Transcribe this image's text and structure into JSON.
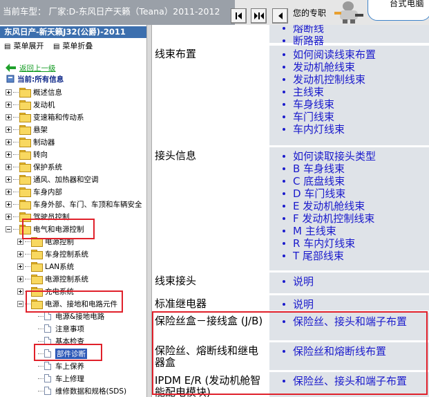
{
  "header": {
    "vehicle_text": "当前车型：  厂家:D-东风日产天籁（Teana）2011-2012",
    "help_text": "您的专职",
    "ad_text": "台式电脑"
  },
  "toolbar": {
    "buttons": [
      {
        "name": "nav-first-button",
        "icon": "first-page-icon"
      },
      {
        "name": "nav-split-button",
        "icon": "expand-icon"
      },
      {
        "name": "nav-back-button",
        "icon": "back-icon"
      }
    ]
  },
  "sidebar": {
    "model_title": "东风日产-新天籁J32(公爵)-2011",
    "expand_menu": "菜单展开",
    "collapse_menu": "菜单折叠",
    "back_link": "返回上一级",
    "current_info": "当前:所有信息",
    "tree": [
      {
        "label": "概述信息",
        "level": 0,
        "type": "folder",
        "expanded": false
      },
      {
        "label": "发动机",
        "level": 0,
        "type": "folder",
        "expanded": false
      },
      {
        "label": "变速箱和传动系",
        "level": 0,
        "type": "folder",
        "expanded": false
      },
      {
        "label": "悬架",
        "level": 0,
        "type": "folder",
        "expanded": false
      },
      {
        "label": "制动器",
        "level": 0,
        "type": "folder",
        "expanded": false
      },
      {
        "label": "转向",
        "level": 0,
        "type": "folder",
        "expanded": false
      },
      {
        "label": "保护系统",
        "level": 0,
        "type": "folder",
        "expanded": false
      },
      {
        "label": "通风、加热器和空调",
        "level": 0,
        "type": "folder",
        "expanded": false
      },
      {
        "label": "车身内部",
        "level": 0,
        "type": "folder",
        "expanded": false
      },
      {
        "label": "车身外部、车门、车顶和车辆安全",
        "level": 0,
        "type": "folder",
        "expanded": false
      },
      {
        "label": "驾驶员控制",
        "level": 0,
        "type": "folder",
        "expanded": false
      },
      {
        "label": "电气和电源控制",
        "level": 0,
        "type": "folder",
        "expanded": true
      },
      {
        "label": "电源控制",
        "level": 1,
        "type": "folder",
        "expanded": false
      },
      {
        "label": "车身控制系统",
        "level": 1,
        "type": "folder",
        "expanded": false
      },
      {
        "label": "LAN系统",
        "level": 1,
        "type": "folder",
        "expanded": false
      },
      {
        "label": "电源控制系统",
        "level": 1,
        "type": "folder",
        "expanded": false
      },
      {
        "label": "充电系统",
        "level": 1,
        "type": "folder",
        "expanded": false
      },
      {
        "label": "电源、接地和电路元件",
        "level": 1,
        "type": "folder",
        "expanded": true
      },
      {
        "label": "电源&接地电路",
        "level": 2,
        "type": "doc"
      },
      {
        "label": "注意事项",
        "level": 2,
        "type": "doc"
      },
      {
        "label": "基本检查",
        "level": 2,
        "type": "doc"
      },
      {
        "label": "部件诊断",
        "level": 2,
        "type": "doc",
        "selected": true
      },
      {
        "label": "车上保养",
        "level": 2,
        "type": "doc"
      },
      {
        "label": "车上修理",
        "level": 2,
        "type": "doc"
      },
      {
        "label": "维修数据和规格(SDS)",
        "level": 2,
        "type": "doc"
      }
    ]
  },
  "content": {
    "rows": [
      {
        "heading": "",
        "items": [
          "熔断线",
          "断路器"
        ]
      },
      {
        "heading": "线束布置",
        "items": [
          "如何阅读线束布置",
          "发动机舱线束",
          "发动机控制线束",
          "主线束",
          "车身线束",
          "车门线束",
          "车内灯线束"
        ]
      },
      {
        "heading": "接头信息",
        "items": [
          "如何读取接头类型",
          "B 车身线束",
          "C 底盘线束",
          "D 车门线束",
          "E 发动机舱线束",
          "F 发动机控制线束",
          "M 主线束",
          "R 车内灯线束",
          "T 尾部线束"
        ]
      },
      {
        "heading": "线束接头",
        "items": [
          "说明"
        ]
      },
      {
        "heading": "标准继电器",
        "items": [
          "说明"
        ]
      },
      {
        "heading": "保险丝盒－接线盒 (J/B)",
        "items": [
          "保险丝、接头和端子布置"
        ]
      },
      {
        "heading": "保险丝、熔断线和继电器盒",
        "items": [
          "保险丝和熔断线布置"
        ]
      },
      {
        "heading": "IPDM E/R (发动机舱智能配电模块)",
        "items": [
          "保险丝、接头和端子布置"
        ]
      }
    ]
  },
  "colors": {
    "title_bar": "#3c6fae",
    "link": "#1b1bcc",
    "highlight_box": "#e0202a",
    "cell_bg": "#dfe3e8"
  }
}
